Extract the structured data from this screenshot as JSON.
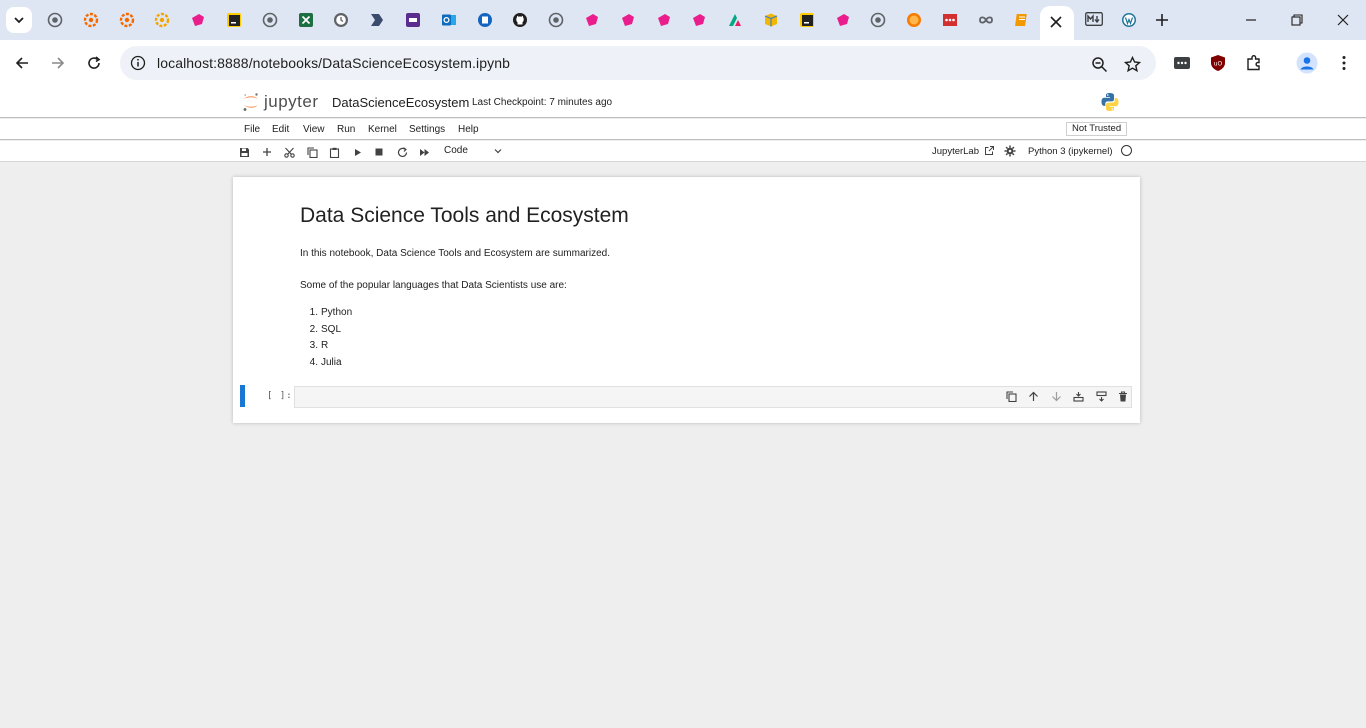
{
  "browser": {
    "url": "localhost:8888/notebooks/DataScienceEcosystem.ipynb",
    "tabs": [
      {
        "icon": "globe-icon",
        "color": "#5f6368"
      },
      {
        "icon": "grafana-icon",
        "color": "#f46800"
      },
      {
        "icon": "grafana-icon",
        "color": "#f46800"
      },
      {
        "icon": "grafana-icon",
        "color": "#f4a400"
      },
      {
        "icon": "app-pink-icon",
        "color": "#e91e8c"
      },
      {
        "icon": "app-dark-icon",
        "color": "#222222"
      },
      {
        "icon": "globe-icon",
        "color": "#5f6368"
      },
      {
        "icon": "excel-icon",
        "color": "#1d6f42"
      },
      {
        "icon": "clock-icon",
        "color": "#5f6368"
      },
      {
        "icon": "arrow-app-icon",
        "color": "#3c4a6b"
      },
      {
        "icon": "video-app-icon",
        "color": "#5b2d8e"
      },
      {
        "icon": "outlook-icon",
        "color": "#0f6cbd"
      },
      {
        "icon": "app-blue-icon",
        "color": "#1565c0"
      },
      {
        "icon": "github-icon",
        "color": "#1f1f1f"
      },
      {
        "icon": "globe-icon",
        "color": "#5f6368"
      },
      {
        "icon": "app-pink-icon",
        "color": "#e91e8c"
      },
      {
        "icon": "app-pink-icon",
        "color": "#e91e8c"
      },
      {
        "icon": "app-pink-icon",
        "color": "#e91e8c"
      },
      {
        "icon": "app-pink-icon",
        "color": "#e91e8c"
      },
      {
        "icon": "app-multicolor-icon",
        "color": "#00a884"
      },
      {
        "icon": "box-icon",
        "color": "#f2b705"
      },
      {
        "icon": "app-dark-icon",
        "color": "#222222"
      },
      {
        "icon": "app-pink-icon",
        "color": "#e91e8c"
      },
      {
        "icon": "globe-icon",
        "color": "#5f6368"
      },
      {
        "icon": "circle-orange-icon",
        "color": "#f57c00"
      },
      {
        "icon": "red-bar-icon",
        "color": "#d32f2f"
      },
      {
        "icon": "infinity-icon",
        "color": "#5f6368"
      },
      {
        "icon": "book-icon",
        "color": "#f29900"
      },
      {
        "icon": "jupyter-tab-icon",
        "color": "#f37726",
        "active": true
      },
      {
        "icon": "markdown-icon",
        "color": "#3c4043"
      },
      {
        "icon": "wordpress-icon",
        "color": "#21759b"
      }
    ]
  },
  "jupyter": {
    "logo_text": "jupyter",
    "notebook_title": "DataScienceEcosystem",
    "checkpoint": "Last Checkpoint: 7 minutes ago",
    "menu": [
      "File",
      "Edit",
      "View",
      "Run",
      "Kernel",
      "Settings",
      "Help"
    ],
    "trust_status": "Not Trusted",
    "cell_type": "Code",
    "jupyterlab_link": "JupyterLab",
    "kernel_name": "Python 3 (ipykernel)"
  },
  "notebook": {
    "heading": "Data Science Tools and Ecosystem",
    "intro": "In this notebook, Data Science Tools and Ecosystem are summarized.",
    "languages_intro": "Some of the popular languages that Data Scientists use are:",
    "languages": [
      "Python",
      "SQL",
      "R",
      "Julia"
    ],
    "code_prompt": "[ ]:"
  },
  "colors": {
    "accent": "#1976d2",
    "jupyter_orange": "#f37726"
  }
}
